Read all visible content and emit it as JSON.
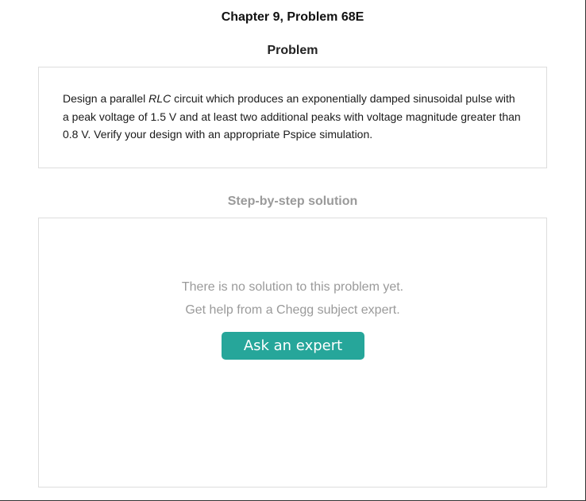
{
  "header": {
    "chapter_title": "Chapter 9, Problem 68E"
  },
  "problem": {
    "heading": "Problem",
    "text_part1": "Design a parallel ",
    "text_italic": "RLC",
    "text_part2": " circuit which produces an exponentially damped sinusoidal pulse with a peak voltage of 1.5 V and at least two additional peaks with voltage magnitude greater than 0.8 V. Verify your design with an appropriate Pspice simulation."
  },
  "solution": {
    "heading": "Step-by-step solution",
    "empty_line1": "There is no solution to this problem yet.",
    "empty_line2": "Get help from a Chegg subject expert.",
    "ask_button_label": "Ask an expert"
  },
  "colors": {
    "accent": "#26a69a",
    "muted_text": "#9a9a9a",
    "border": "#dddddd"
  }
}
